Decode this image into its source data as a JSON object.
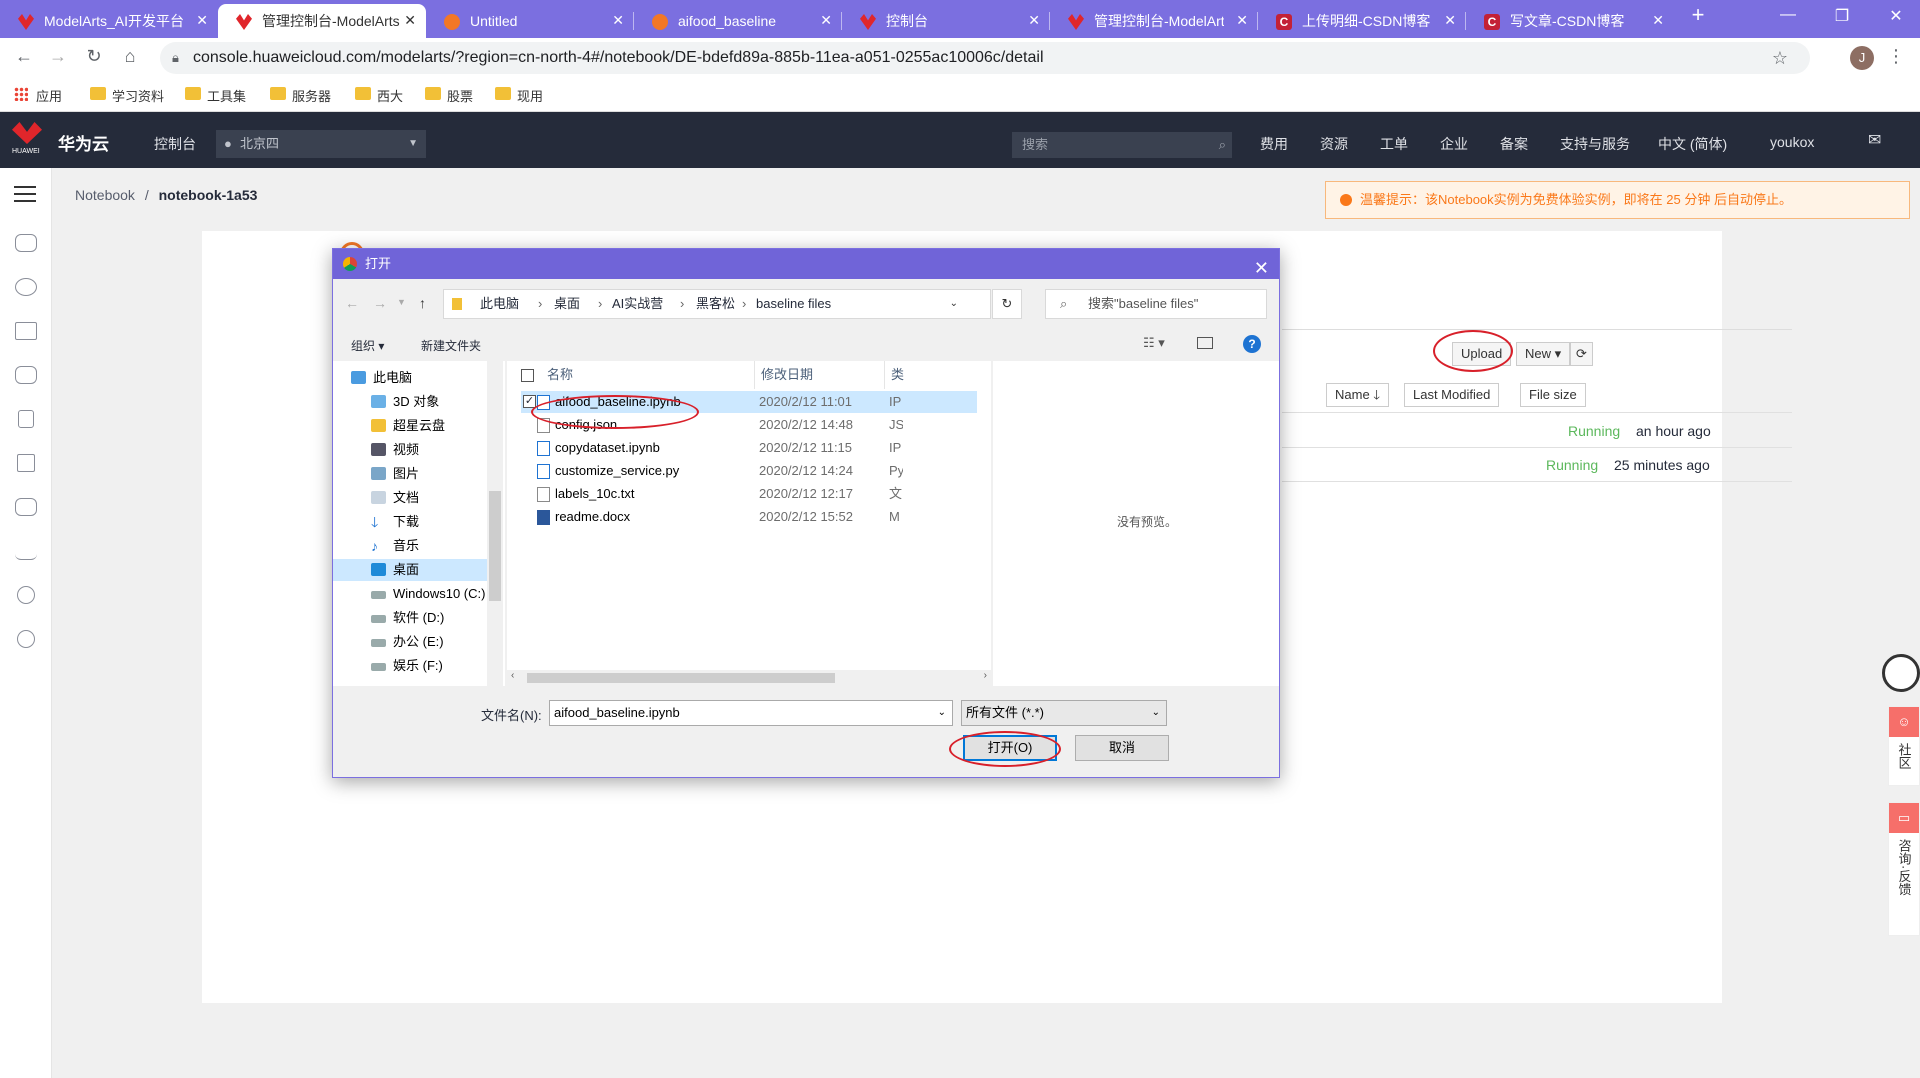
{
  "browser": {
    "tabs": [
      {
        "title": "ModelArts_AI开发平台",
        "favicon": "huawei",
        "active": false
      },
      {
        "title": "管理控制台-ModelArts",
        "favicon": "huawei",
        "active": true
      },
      {
        "title": "Untitled",
        "favicon": "jupyter",
        "active": false
      },
      {
        "title": "aifood_baseline",
        "favicon": "jupyter",
        "active": false
      },
      {
        "title": "控制台",
        "favicon": "huawei",
        "active": false
      },
      {
        "title": "管理控制台-ModelArts",
        "favicon": "huawei",
        "active": false
      },
      {
        "title": "上传明细-CSDN博客",
        "favicon": "csdn",
        "active": false
      },
      {
        "title": "写文章-CSDN博客",
        "favicon": "csdn",
        "active": false
      }
    ],
    "url": "console.huaweicloud.com/modelarts/?region=cn-north-4#/notebook/DE-bdefd89a-885b-11ea-a051-0255ac10006c/detail",
    "profile_initial": "J",
    "bookmarks": [
      "应用",
      "学习资料",
      "工具集",
      "服务器",
      "西大",
      "股票",
      "现用"
    ]
  },
  "huawei": {
    "logo_text": "华为云",
    "logo_sub": "HUAWEI",
    "console": "控制台",
    "region": "北京四",
    "search_placeholder": "搜索",
    "nav": [
      "费用",
      "资源",
      "工单",
      "企业",
      "备案",
      "支持与服务",
      "中文 (简体)",
      "youkox"
    ]
  },
  "breadcrumb": {
    "root": "Notebook",
    "sep": "/",
    "current": "notebook-1a53"
  },
  "warning": "温馨提示：该Notebook实例为免费体验实例，即将在 25 分钟 后自动停止。",
  "jupyter": {
    "upload": "Upload",
    "new": "New",
    "columns": [
      "Name",
      "Last Modified",
      "File size"
    ],
    "rows": [
      {
        "status": "Running",
        "modified": "an hour ago"
      },
      {
        "status": "Running",
        "modified": "25 minutes ago"
      }
    ]
  },
  "right_widgets": [
    "社区",
    "咨询·反馈"
  ],
  "dialog": {
    "title": "打开",
    "path": [
      "此电脑",
      "桌面",
      "AI实战营",
      "黑客松",
      "baseline files"
    ],
    "search_placeholder": "搜索\"baseline files\"",
    "organize": "组织",
    "new_folder": "新建文件夹",
    "tree": [
      {
        "label": "此电脑",
        "icon": "pc"
      },
      {
        "label": "3D 对象",
        "icon": "folder-3d"
      },
      {
        "label": "超星云盘",
        "icon": "folder"
      },
      {
        "label": "视频",
        "icon": "video"
      },
      {
        "label": "图片",
        "icon": "picture"
      },
      {
        "label": "文档",
        "icon": "document"
      },
      {
        "label": "下载",
        "icon": "download"
      },
      {
        "label": "音乐",
        "icon": "music"
      },
      {
        "label": "桌面",
        "icon": "desktop"
      },
      {
        "label": "Windows10 (C:)",
        "icon": "drive"
      },
      {
        "label": "软件 (D:)",
        "icon": "drive"
      },
      {
        "label": "办公 (E:)",
        "icon": "drive"
      },
      {
        "label": "娱乐 (F:)",
        "icon": "drive"
      }
    ],
    "columns": {
      "name": "名称",
      "date": "修改日期",
      "type": "类"
    },
    "files": [
      {
        "name": "aifood_baseline.ipynb",
        "date": "2020/2/12 11:01",
        "type": "IP"
      },
      {
        "name": "config.json",
        "date": "2020/2/12 14:48",
        "type": "JS"
      },
      {
        "name": "copydataset.ipynb",
        "date": "2020/2/12 11:15",
        "type": "IP"
      },
      {
        "name": "customize_service.py",
        "date": "2020/2/12 14:24",
        "type": "Py"
      },
      {
        "name": "labels_10c.txt",
        "date": "2020/2/12 12:17",
        "type": "文"
      },
      {
        "name": "readme.docx",
        "date": "2020/2/12 15:52",
        "type": "M"
      }
    ],
    "no_preview": "没有预览。",
    "filename_label": "文件名(N):",
    "filename_value": "aifood_baseline.ipynb",
    "filetype": "所有文件 (*.*)",
    "open": "打开(O)",
    "cancel": "取消"
  },
  "colors": {
    "tabstrip": "#7b6fe0",
    "header": "#252b3a",
    "warning": "#fa7819",
    "running": "#5cb85c",
    "annotation": "#d8202a"
  }
}
